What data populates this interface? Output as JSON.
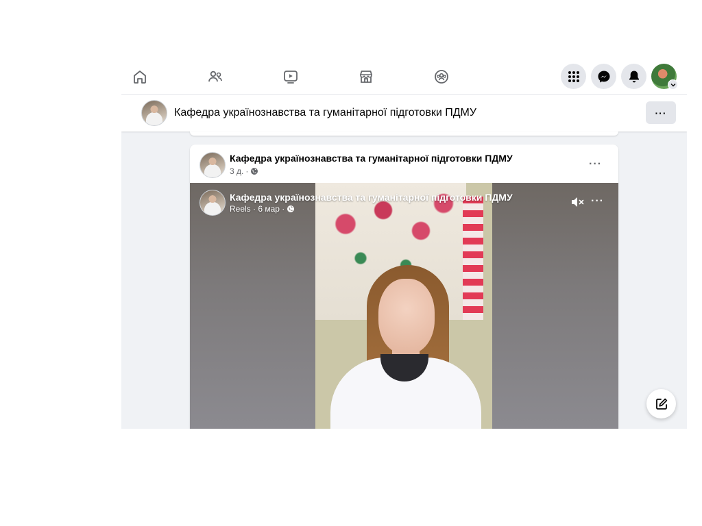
{
  "nav": {
    "icons": [
      "home-icon",
      "friends-icon",
      "video-icon",
      "marketplace-icon",
      "groups-icon"
    ],
    "right": [
      "menu-grid-icon",
      "messenger-icon",
      "notifications-bell-icon",
      "profile-avatar"
    ]
  },
  "page_header": {
    "title": "Кафедра українознавства та гуманітарної підготовки ПДМУ",
    "more_label": "···"
  },
  "post": {
    "author": "Кафедра українознавства та гуманітарної підготовки ПДМУ",
    "time": "3 д.",
    "separator": "·",
    "privacy_icon": "globe-icon",
    "more_label": "···",
    "video": {
      "author": "Кафедра українознавства та гуманітарної підготовки ПДМУ",
      "meta": "Reels · 6 мар ·",
      "mute_icon": "muted-speaker-icon",
      "more_label": "···"
    }
  },
  "fab": {
    "icon": "compose-icon"
  },
  "colors": {
    "accent": "#1877f2",
    "nav_bg": "#ffffff",
    "feed_bg": "#f0f2f5"
  }
}
